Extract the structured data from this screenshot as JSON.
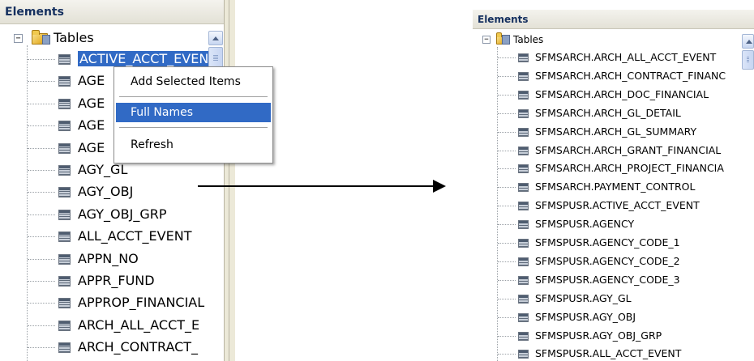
{
  "left_panel": {
    "header": "Elements",
    "root": {
      "label": "Tables",
      "expander": "−"
    },
    "items": [
      {
        "label": "ACTIVE_ACCT_EVEN",
        "selected": true
      },
      {
        "label": "AGE"
      },
      {
        "label": "AGE"
      },
      {
        "label": "AGE"
      },
      {
        "label": "AGE"
      },
      {
        "label": "AGY_GL"
      },
      {
        "label": "AGY_OBJ"
      },
      {
        "label": "AGY_OBJ_GRP"
      },
      {
        "label": "ALL_ACCT_EVENT"
      },
      {
        "label": "APPN_NO"
      },
      {
        "label": "APPR_FUND"
      },
      {
        "label": "APPROP_FINANCIAL"
      },
      {
        "label": "ARCH_ALL_ACCT_E"
      },
      {
        "label": "ARCH_CONTRACT_"
      }
    ]
  },
  "context_menu": {
    "items": [
      {
        "label": "Add Selected Items"
      },
      {
        "label": "Full Names",
        "highlighted": true
      },
      {
        "label": "Refresh"
      }
    ]
  },
  "right_panel": {
    "header": "Elements",
    "root": {
      "label": "Tables",
      "expander": "−"
    },
    "items": [
      {
        "label": "SFMSARCH.ARCH_ALL_ACCT_EVENT"
      },
      {
        "label": "SFMSARCH.ARCH_CONTRACT_FINANC"
      },
      {
        "label": "SFMSARCH.ARCH_DOC_FINANCIAL"
      },
      {
        "label": "SFMSARCH.ARCH_GL_DETAIL"
      },
      {
        "label": "SFMSARCH.ARCH_GL_SUMMARY"
      },
      {
        "label": "SFMSARCH.ARCH_GRANT_FINANCIAL"
      },
      {
        "label": "SFMSARCH.ARCH_PROJECT_FINANCIA"
      },
      {
        "label": "SFMSARCH.PAYMENT_CONTROL"
      },
      {
        "label": "SFMSPUSR.ACTIVE_ACCT_EVENT"
      },
      {
        "label": "SFMSPUSR.AGENCY"
      },
      {
        "label": "SFMSPUSR.AGENCY_CODE_1"
      },
      {
        "label": "SFMSPUSR.AGENCY_CODE_2"
      },
      {
        "label": "SFMSPUSR.AGENCY_CODE_3"
      },
      {
        "label": "SFMSPUSR.AGY_GL"
      },
      {
        "label": "SFMSPUSR.AGY_OBJ"
      },
      {
        "label": "SFMSPUSR.AGY_OBJ_GRP"
      },
      {
        "label": "SFMSPUSR.ALL_ACCT_EVENT"
      }
    ]
  },
  "colors": {
    "selection": "#316ac5",
    "header_text": "#15305f",
    "arrow": "#000000"
  }
}
